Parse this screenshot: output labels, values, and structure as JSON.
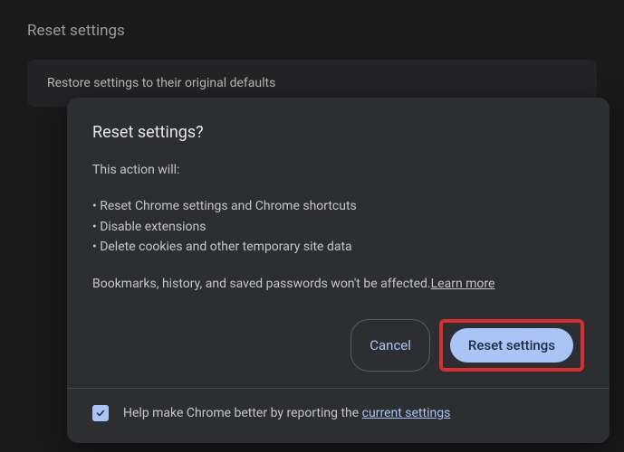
{
  "backdrop": {
    "title": "Reset settings",
    "card_text": "Restore settings to their original defaults"
  },
  "dialog": {
    "title": "Reset settings?",
    "intro": "This action will:",
    "bullets": [
      "• Reset Chrome settings and Chrome shortcuts",
      "• Disable extensions",
      "• Delete cookies and other temporary site data"
    ],
    "note": "Bookmarks, history, and saved passwords won't be affected.",
    "learn_more": "Learn more",
    "cancel_label": "Cancel",
    "confirm_label": "Reset settings",
    "footer_text_prefix": "Help make Chrome better by reporting the ",
    "footer_link": "current settings"
  }
}
